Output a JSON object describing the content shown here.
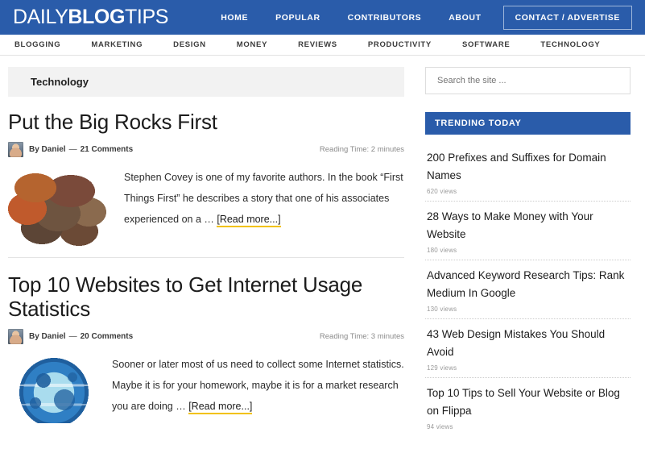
{
  "header": {
    "logo": {
      "part1": "DAILY",
      "part2": "BLOG",
      "part3": "TIPS"
    },
    "nav": [
      {
        "label": "HOME"
      },
      {
        "label": "POPULAR"
      },
      {
        "label": "CONTRIBUTORS"
      },
      {
        "label": "ABOUT"
      }
    ],
    "cta_label": "CONTACT / ADVERTISE"
  },
  "category_nav": [
    {
      "label": "BLOGGING"
    },
    {
      "label": "MARKETING"
    },
    {
      "label": "DESIGN"
    },
    {
      "label": "MONEY"
    },
    {
      "label": "REVIEWS"
    },
    {
      "label": "PRODUCTIVITY"
    },
    {
      "label": "SOFTWARE"
    },
    {
      "label": "TECHNOLOGY"
    }
  ],
  "main": {
    "archive_title": "Technology",
    "articles": [
      {
        "title": "Put the Big Rocks First",
        "author": "By Daniel",
        "dash": "—",
        "comments": "21 Comments",
        "reading_time": "Reading Time: 2 minutes",
        "excerpt": "Stephen Covey is one of my favorite authors. In the book “First Things First” he describes a story that one of his associates experienced on a … ",
        "read_more": "[Read more...]",
        "thumb": "rocks-image"
      },
      {
        "title": "Top 10 Websites to Get Internet Usage Statistics",
        "author": "By Daniel",
        "dash": "—",
        "comments": "20 Comments",
        "reading_time": "Reading Time: 3 minutes",
        "excerpt": "Sooner or later most of us need to collect some Internet statistics. Maybe it is for your homework, maybe it is for a market research you are doing … ",
        "read_more": "[Read more...]",
        "thumb": "globe-image"
      }
    ]
  },
  "sidebar": {
    "search": {
      "placeholder": "Search the site ...",
      "value": ""
    },
    "trending": {
      "title": "TRENDING TODAY",
      "items": [
        {
          "title": "200 Prefixes and Suffixes for Domain Names",
          "views": "620 views"
        },
        {
          "title": "28 Ways to Make Money with Your Website",
          "views": "180 views"
        },
        {
          "title": "Advanced Keyword Research Tips: Rank Medium In Google",
          "views": "130 views"
        },
        {
          "title": "43 Web Design Mistakes You Should Avoid",
          "views": "129 views"
        },
        {
          "title": "Top 10 Tips to Sell Your Website or Blog on Flippa",
          "views": "94 views"
        }
      ]
    }
  },
  "colors": {
    "brand_blue": "#2a5caa",
    "link_underline_yellow": "#f2c200",
    "archive_bar_gray": "#f2f2f2"
  }
}
